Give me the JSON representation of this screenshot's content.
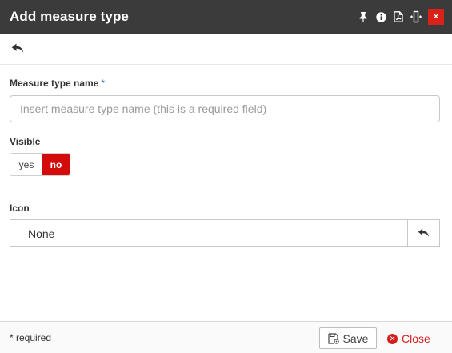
{
  "window": {
    "title": "Add measure type",
    "icons": [
      "pin-icon",
      "info-icon",
      "pdf-icon",
      "resize-icon"
    ],
    "close_label": "×"
  },
  "toolbar": {
    "back_icon": "reply-arrow-icon"
  },
  "form": {
    "name_label": "Measure type name",
    "required_marker": "*",
    "name_placeholder": "Insert measure type name (this is a required field)",
    "name_value": "",
    "visible_label": "Visible",
    "visible_options": [
      "yes",
      "no"
    ],
    "visible_selected": "no",
    "icon_label": "Icon",
    "icon_value": "None",
    "icon_reset_icon": "reply-arrow-icon"
  },
  "footer": {
    "required_note": "* required",
    "save_label": "Save",
    "close_label": "Close"
  },
  "colors": {
    "titlebar": "#3b3b3b",
    "close_red": "#d9211a",
    "toggle_active": "#d40b0b",
    "required_star": "#2a7dc6"
  }
}
